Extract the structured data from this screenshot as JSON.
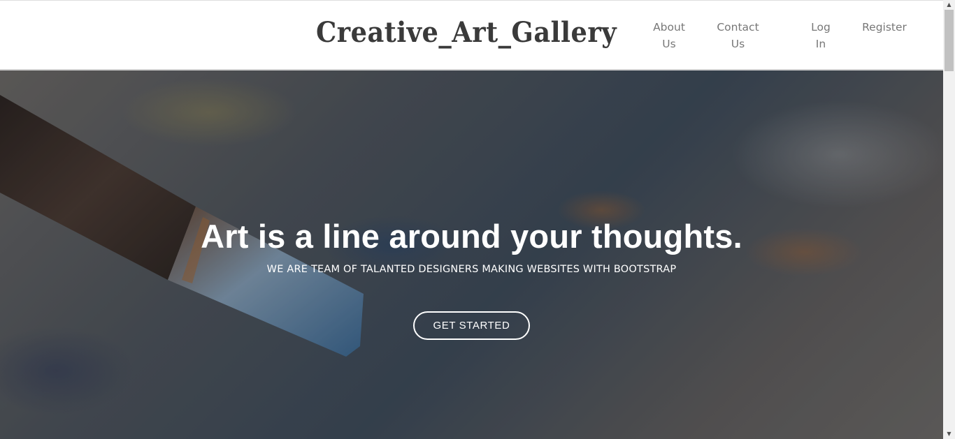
{
  "header": {
    "brand": "Creative_Art_Gallery",
    "nav": [
      {
        "line1": "About",
        "line2": "Us"
      },
      {
        "line1": "Contact",
        "line2": "Us"
      },
      {
        "line1": "Log",
        "line2": "In"
      },
      {
        "line1": "Register",
        "line2": ""
      }
    ]
  },
  "hero": {
    "title": "Art is a line around your thoughts.",
    "subtitle": "WE ARE TEAM OF TALANTED DESIGNERS MAKING WEBSITES WITH BOOTSTRAP",
    "cta_label": "GET STARTED"
  },
  "colors": {
    "brand_text": "#3a3a3a",
    "nav_text": "#777777",
    "hero_text": "#ffffff"
  },
  "icons": {
    "scroll_up": "triangle-up",
    "scroll_down": "triangle-down"
  }
}
